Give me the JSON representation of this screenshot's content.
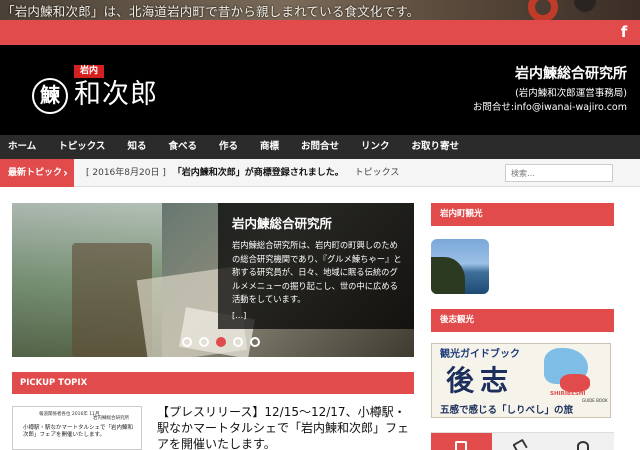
{
  "topbar": {
    "tagline": "「岩内鰊和次郎」は、北海道岩内町で昔から親しまれている食文化です。"
  },
  "social": {
    "facebook_glyph": "f",
    "facebook_icon": "facebook-icon"
  },
  "header": {
    "logo_kanji": "鰊",
    "logo_tag": "岩内",
    "logo_text": "和次郎",
    "org_name": "岩内鰊総合研究所",
    "org_sub": "(岩内鰊和次郎運営事務局)",
    "contact": "お問合せ:info@iwanai-wajiro.com"
  },
  "nav": {
    "items": [
      "ホーム",
      "トピックス",
      "知る",
      "食べる",
      "作る",
      "商標",
      "お問合せ",
      "リンク",
      "お取り寄せ"
    ]
  },
  "breaking": {
    "label": "最新トピック",
    "chevron": "›",
    "date": "[ 2016年8月20日 ]",
    "title": "「岩内鰊和次郎」が商標登録されました。",
    "category": "トピックス",
    "search_placeholder": "検索…"
  },
  "slider": {
    "title": "岩内鰊総合研究所",
    "text": "岩内鰊総合研究所は、岩内町の町興しのための総合研究機関であり、『グルメ鰊ちゃー』と称する研究員が、日々、地域に眠る伝統のグルメメニューの掘り起こし、世の中に広める活動をしています。",
    "more": "[...]",
    "active_dot": 3,
    "dot_count": 5
  },
  "pickup": {
    "header": "PICKUP TOPIX",
    "thumb_line1": "報道関係者各位 2016年 11月",
    "thumb_line2": "岩内鰊総合研究所",
    "thumb_line3": "小樽駅・駅なかマートタルシェで「岩内鰊和次郎」フェアを開催いたします。",
    "title": "【プレスリリース】12/15〜12/17、小樽駅・駅なかマートタルシェで「岩内鰊和次郎」フェアを開催いたします。"
  },
  "sidebar": {
    "section1": "岩内町観光",
    "section2": "後志観光",
    "banner_top": "観光ガイドブック",
    "banner_big": "後志",
    "banner_map_label": "SHIRIBESHI",
    "banner_map_sub": "GUIDE BOOK",
    "banner_bottom": "五感で感じる「しりべし」の旅"
  }
}
